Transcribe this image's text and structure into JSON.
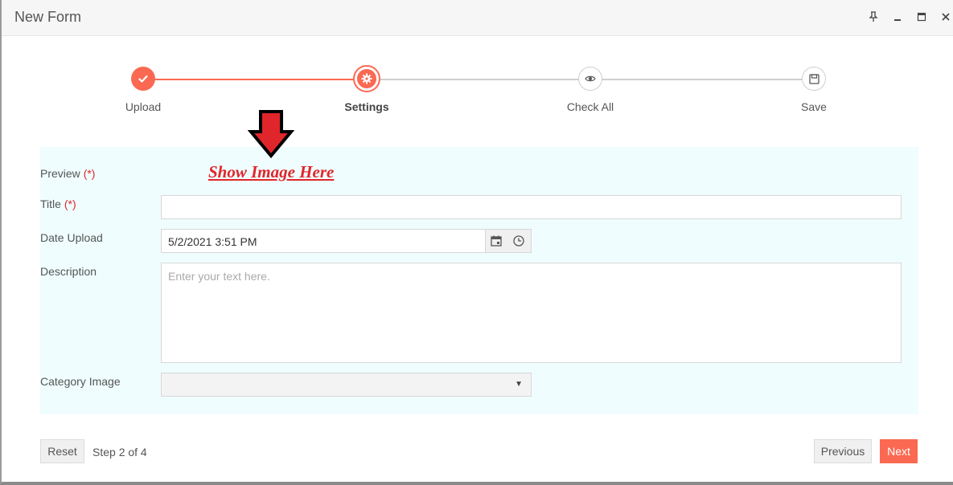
{
  "window": {
    "title": "New Form",
    "buttons": [
      "pin-icon",
      "minimize-icon",
      "maximize-icon",
      "close-icon"
    ]
  },
  "stepper": {
    "steps": [
      {
        "label": "Upload",
        "state": "done",
        "icon": "check-icon"
      },
      {
        "label": "Settings",
        "state": "active",
        "icon": "gear-icon"
      },
      {
        "label": "Check All",
        "state": "pending",
        "icon": "eye-icon"
      },
      {
        "label": "Save",
        "state": "pending",
        "icon": "save-icon"
      }
    ]
  },
  "annotation": {
    "text": "Show Image Here",
    "arrow_icon": "red-down-arrow-icon"
  },
  "form": {
    "preview_label": "Preview",
    "title_label": "Title",
    "title_value": "",
    "required_mark": "(*)",
    "date_label": "Date Upload",
    "date_value": "5/2/2021 3:51 PM",
    "description_label": "Description",
    "description_placeholder": "Enter your text here.",
    "category_label": "Category Image",
    "category_value": ""
  },
  "footer": {
    "reset_label": "Reset",
    "step_text": "Step 2 of 4",
    "previous_label": "Previous",
    "next_label": "Next"
  },
  "colors": {
    "accent": "#fb6952",
    "panel_bg": "#effdfe",
    "annotation": "#e0262a"
  }
}
